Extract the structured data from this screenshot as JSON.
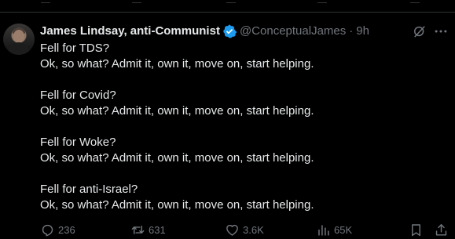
{
  "post": {
    "author": {
      "display_name": "James Lindsay, anti-Communist",
      "handle": "@ConceptualJames",
      "verified": true,
      "separator": "·",
      "time": "9h"
    },
    "paragraphs": [
      {
        "line1": "Fell for TDS?",
        "line2": "Ok, so what? Admit it, own it, move on, start helping."
      },
      {
        "line1": "Fell for Covid?",
        "line2": "Ok, so what? Admit it, own it, move on, start helping."
      },
      {
        "line1": "Fell for Woke?",
        "line2": "Ok, so what? Admit it, own it, move on, start helping."
      },
      {
        "line1": "Fell for anti-Israel?",
        "line2": "Ok, so what? Admit it, own it, move on, start helping."
      }
    ],
    "metrics": {
      "replies": "236",
      "reposts": "631",
      "likes": "3.6K",
      "views": "65K"
    }
  },
  "colors": {
    "background": "#000000",
    "text": "#e7e9ea",
    "secondary": "#71767b",
    "verified_badge": "#1d9bf0",
    "divider": "#2f3336"
  },
  "icons": {
    "verified": "verified-badge-icon",
    "grok": "grok-icon",
    "more": "more-icon",
    "reply": "reply-icon",
    "repost": "repost-icon",
    "like": "heart-icon",
    "views": "views-icon",
    "bookmark": "bookmark-icon",
    "share": "share-icon"
  }
}
